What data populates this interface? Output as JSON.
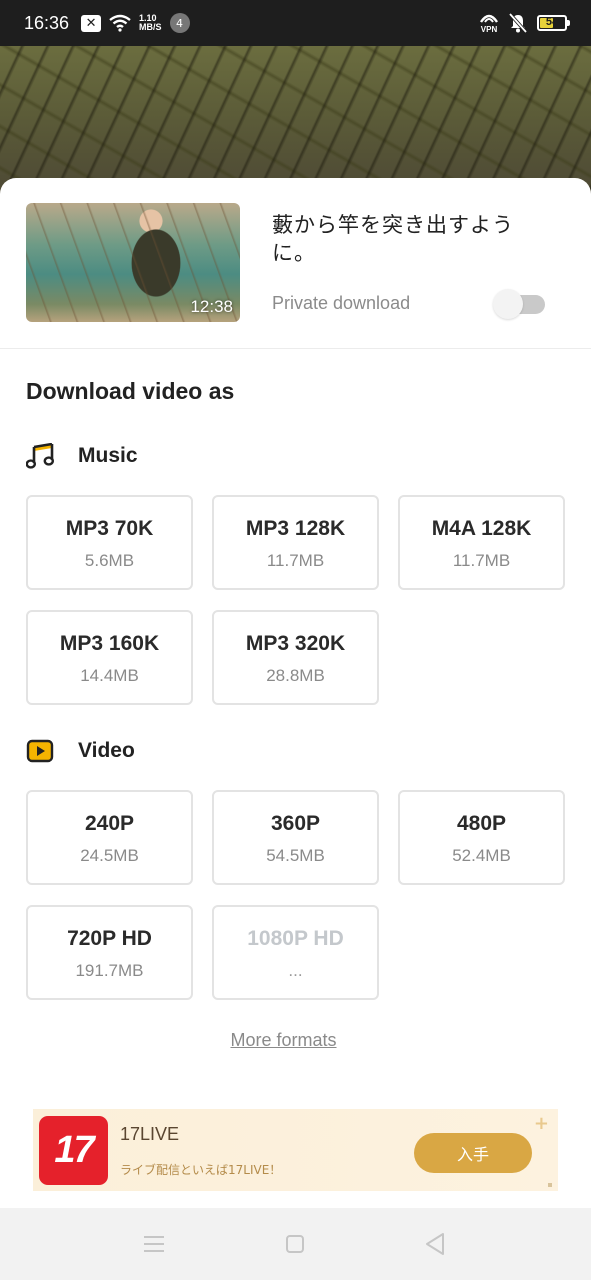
{
  "status_bar": {
    "time": "16:36",
    "net_speed_value": "1.10",
    "net_speed_unit": "MB/S",
    "notification_count": "4",
    "vpn_label": "VPN",
    "battery_level": "54"
  },
  "video": {
    "title": "藪から竿を突き出すように。",
    "duration": "12:38",
    "private_download_label": "Private download",
    "private_download_enabled": false
  },
  "download": {
    "heading": "Download video as",
    "music": {
      "label": "Music",
      "icon": "music-note-icon",
      "options": [
        {
          "name": "MP3 70K",
          "size": "5.6MB"
        },
        {
          "name": "MP3 128K",
          "size": "11.7MB"
        },
        {
          "name": "M4A 128K",
          "size": "11.7MB"
        },
        {
          "name": "MP3 160K",
          "size": "14.4MB"
        },
        {
          "name": "MP3 320K",
          "size": "28.8MB"
        }
      ]
    },
    "video": {
      "label": "Video",
      "icon": "play-box-icon",
      "options": [
        {
          "name": "240P",
          "size": "24.5MB"
        },
        {
          "name": "360P",
          "size": "54.5MB"
        },
        {
          "name": "480P",
          "size": "52.4MB"
        },
        {
          "name": "720P HD",
          "size": "191.7MB"
        },
        {
          "name": "1080P HD",
          "size": "...",
          "disabled": true
        }
      ]
    },
    "more_formats": "More formats"
  },
  "ad": {
    "logo_text": "17",
    "name": "17LIVE",
    "description": "ライブ配信といえば17LIVE！",
    "cta": "入手"
  },
  "colors": {
    "accent": "#f5b400",
    "ad_cta": "#d9a744",
    "ad_logo": "#e5212b"
  }
}
